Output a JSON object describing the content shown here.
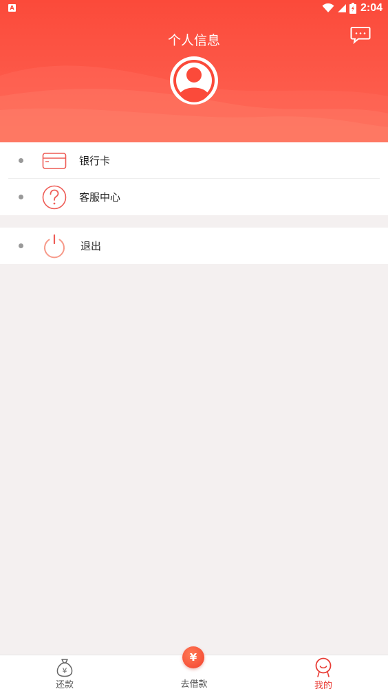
{
  "status_bar": {
    "left_badge": "A",
    "time": "2:04"
  },
  "header": {
    "title": "个人信息",
    "message_icon": "chat-bubble-icon",
    "avatar_icon": "user-avatar-icon"
  },
  "menu": {
    "group1": [
      {
        "label": "银行卡",
        "icon": "bank-card-icon"
      },
      {
        "label": "客服中心",
        "icon": "question-icon"
      }
    ],
    "group2": [
      {
        "label": "退出",
        "icon": "power-icon"
      }
    ]
  },
  "tabbar": {
    "items": [
      {
        "label": "还款",
        "icon": "money-bag-icon",
        "active": false
      },
      {
        "label": "去借款",
        "icon": "yuan-coin-icon",
        "active": false
      },
      {
        "label": "我的",
        "icon": "person-icon",
        "active": true
      }
    ],
    "borrow_symbol": "¥"
  },
  "colors": {
    "accent": "#f4473a",
    "inactive": "#555555",
    "background": "#f4f0f0"
  }
}
